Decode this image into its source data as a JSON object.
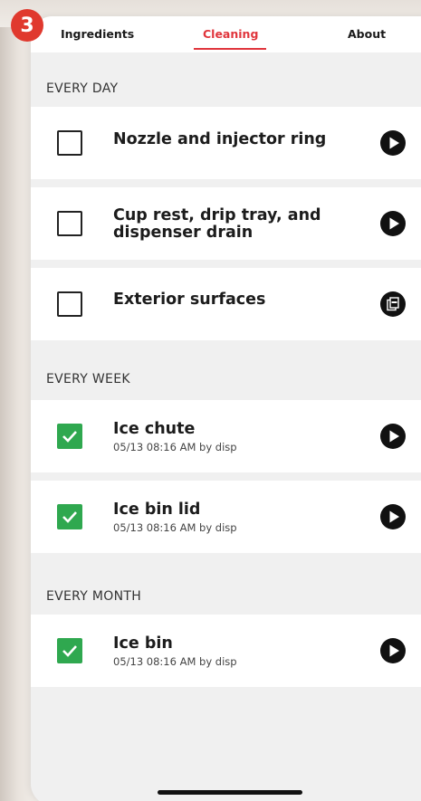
{
  "step_badge": "3",
  "tabs": [
    {
      "label": "Ingredients",
      "active": false
    },
    {
      "label": "Cleaning",
      "active": true
    },
    {
      "label": "About",
      "active": false
    }
  ],
  "accent_color": "#e0353c",
  "check_color": "#2fa84f",
  "sections": [
    {
      "header": "EVERY DAY",
      "items": [
        {
          "title": "Nozzle and injector ring",
          "checked": false,
          "subtitle": "",
          "action_icon": "play-icon"
        },
        {
          "title": "Cup rest, drip tray, and dispenser drain",
          "checked": false,
          "subtitle": "",
          "action_icon": "play-icon"
        },
        {
          "title": "Exterior surfaces",
          "checked": false,
          "subtitle": "",
          "action_icon": "pdf-icon"
        }
      ]
    },
    {
      "header": "EVERY WEEK",
      "items": [
        {
          "title": "Ice chute",
          "checked": true,
          "subtitle": "05/13 08:16 AM by disp",
          "action_icon": "play-icon"
        },
        {
          "title": "Ice bin lid",
          "checked": true,
          "subtitle": "05/13 08:16 AM by disp",
          "action_icon": "play-icon"
        }
      ]
    },
    {
      "header": "EVERY MONTH",
      "items": [
        {
          "title": "Ice bin",
          "checked": true,
          "subtitle": "05/13 08:16 AM by disp",
          "action_icon": "play-icon"
        }
      ]
    }
  ]
}
